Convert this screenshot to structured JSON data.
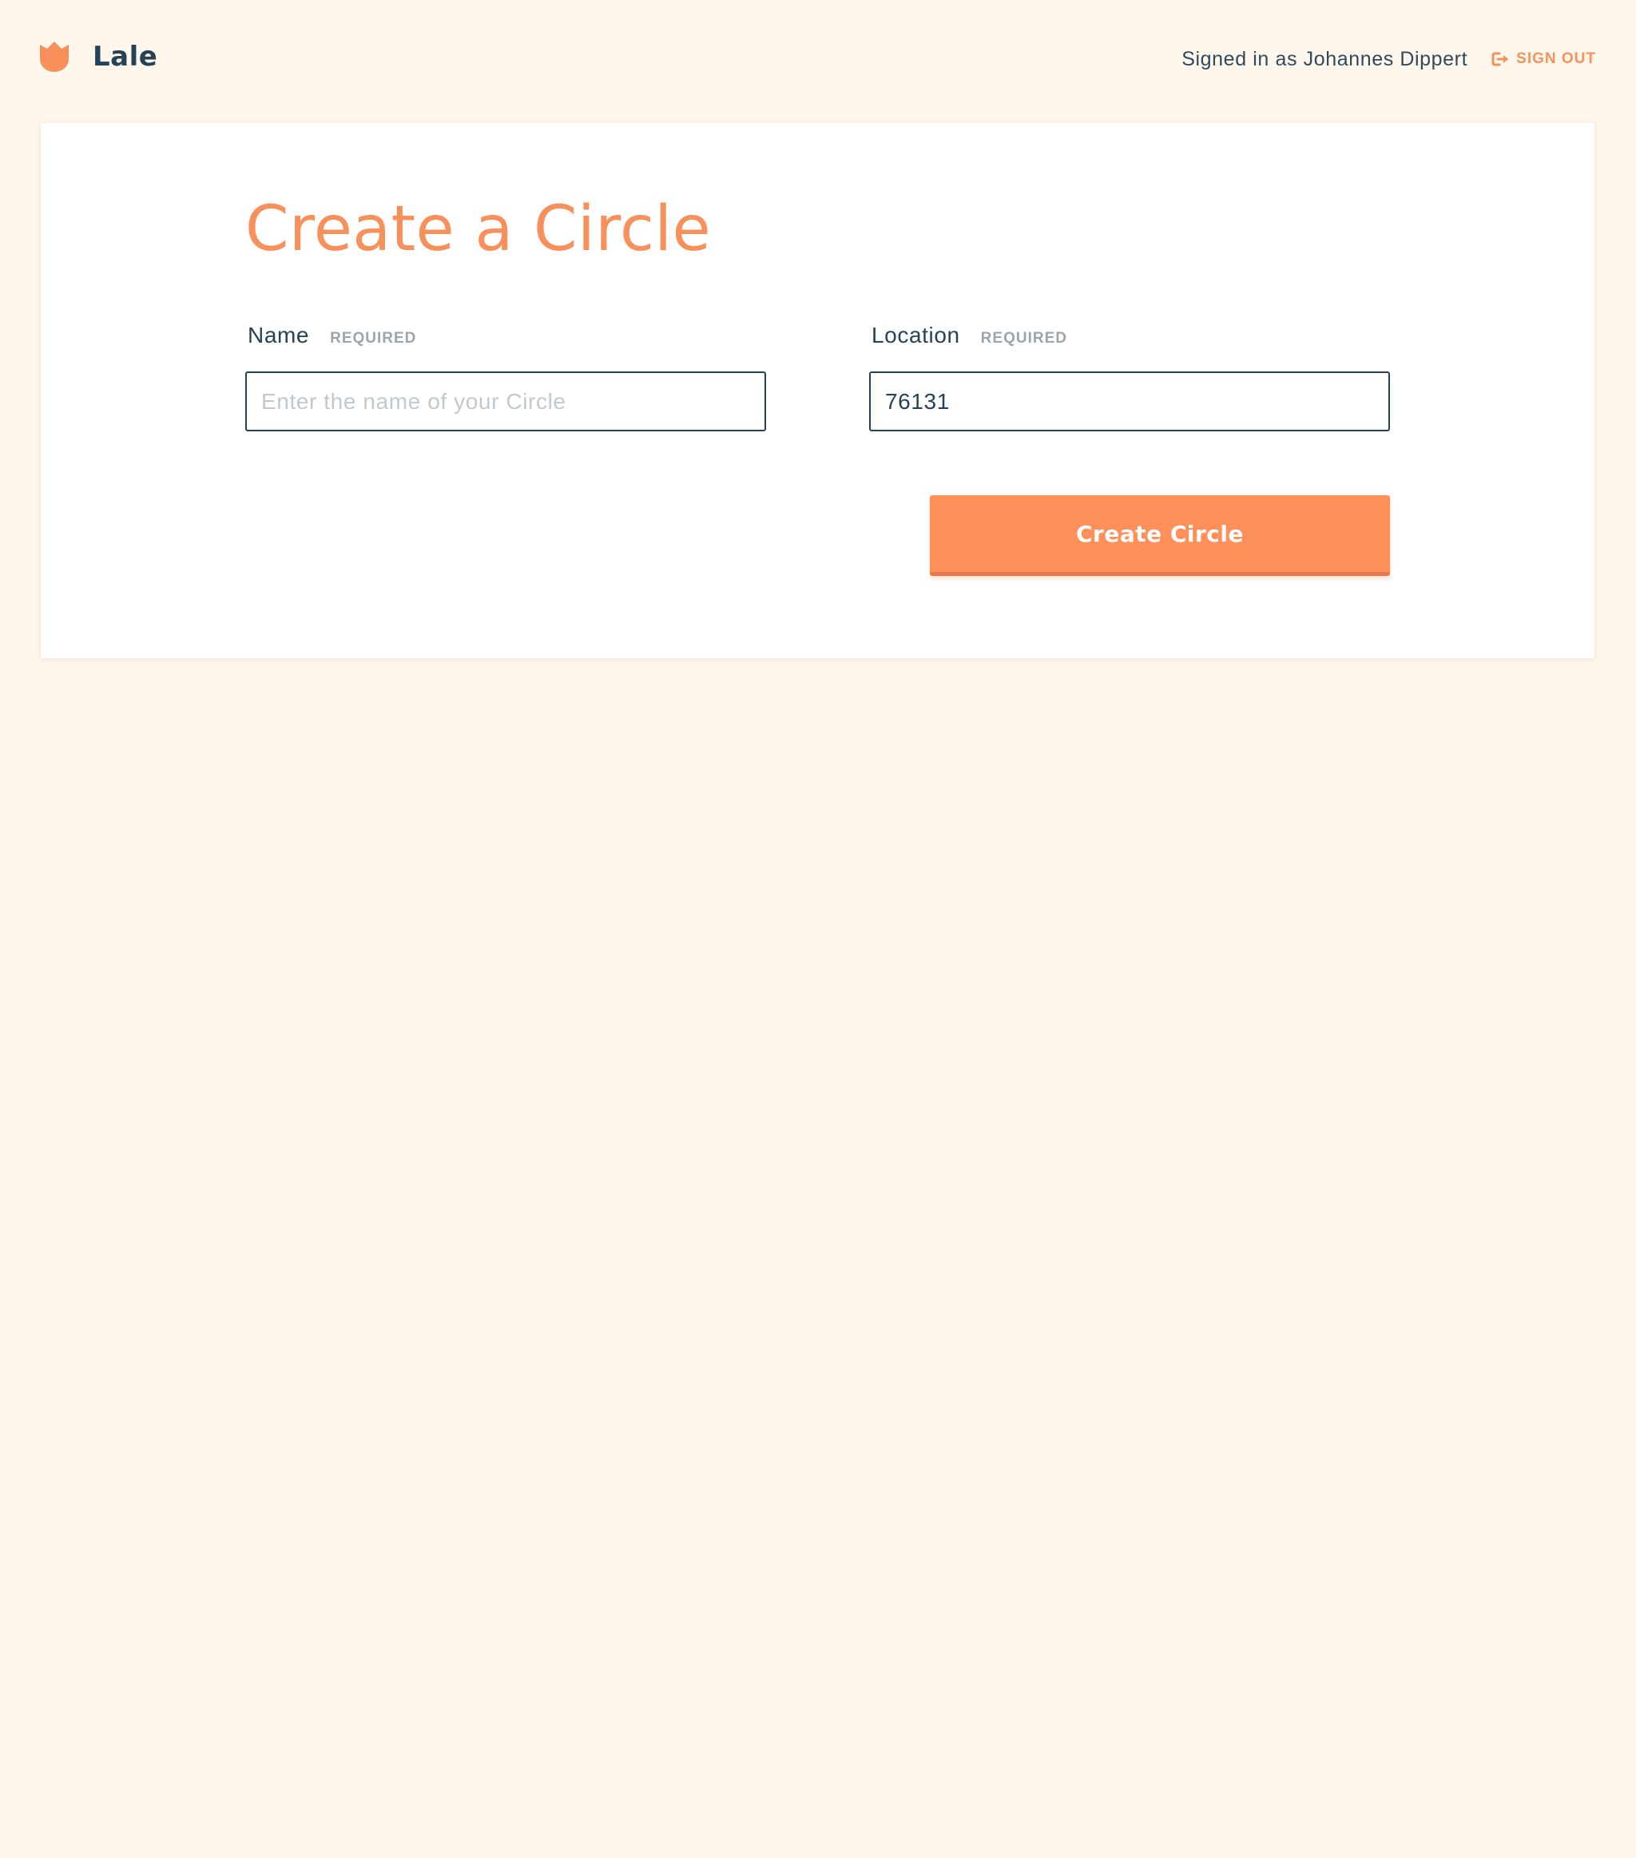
{
  "header": {
    "brand": {
      "name": "Lale",
      "logo_icon": "tulip-icon"
    },
    "user": {
      "signed_in_text": "Signed in as Johannes Dippert",
      "sign_out_label": "SIGN OUT",
      "sign_out_icon": "sign-out-icon"
    }
  },
  "form": {
    "title": "Create a Circle",
    "name_field": {
      "label": "Name",
      "required_label": "REQUIRED",
      "value": "",
      "placeholder": "Enter the name of your Circle"
    },
    "location_field": {
      "label": "Location",
      "required_label": "REQUIRED",
      "value": "76131",
      "placeholder": ""
    },
    "submit_label": "Create Circle"
  },
  "colors": {
    "background": "#fff7ec",
    "accent": "#f7905a",
    "button": "#ff9059",
    "text": "#264256",
    "muted": "#9aa6af"
  }
}
